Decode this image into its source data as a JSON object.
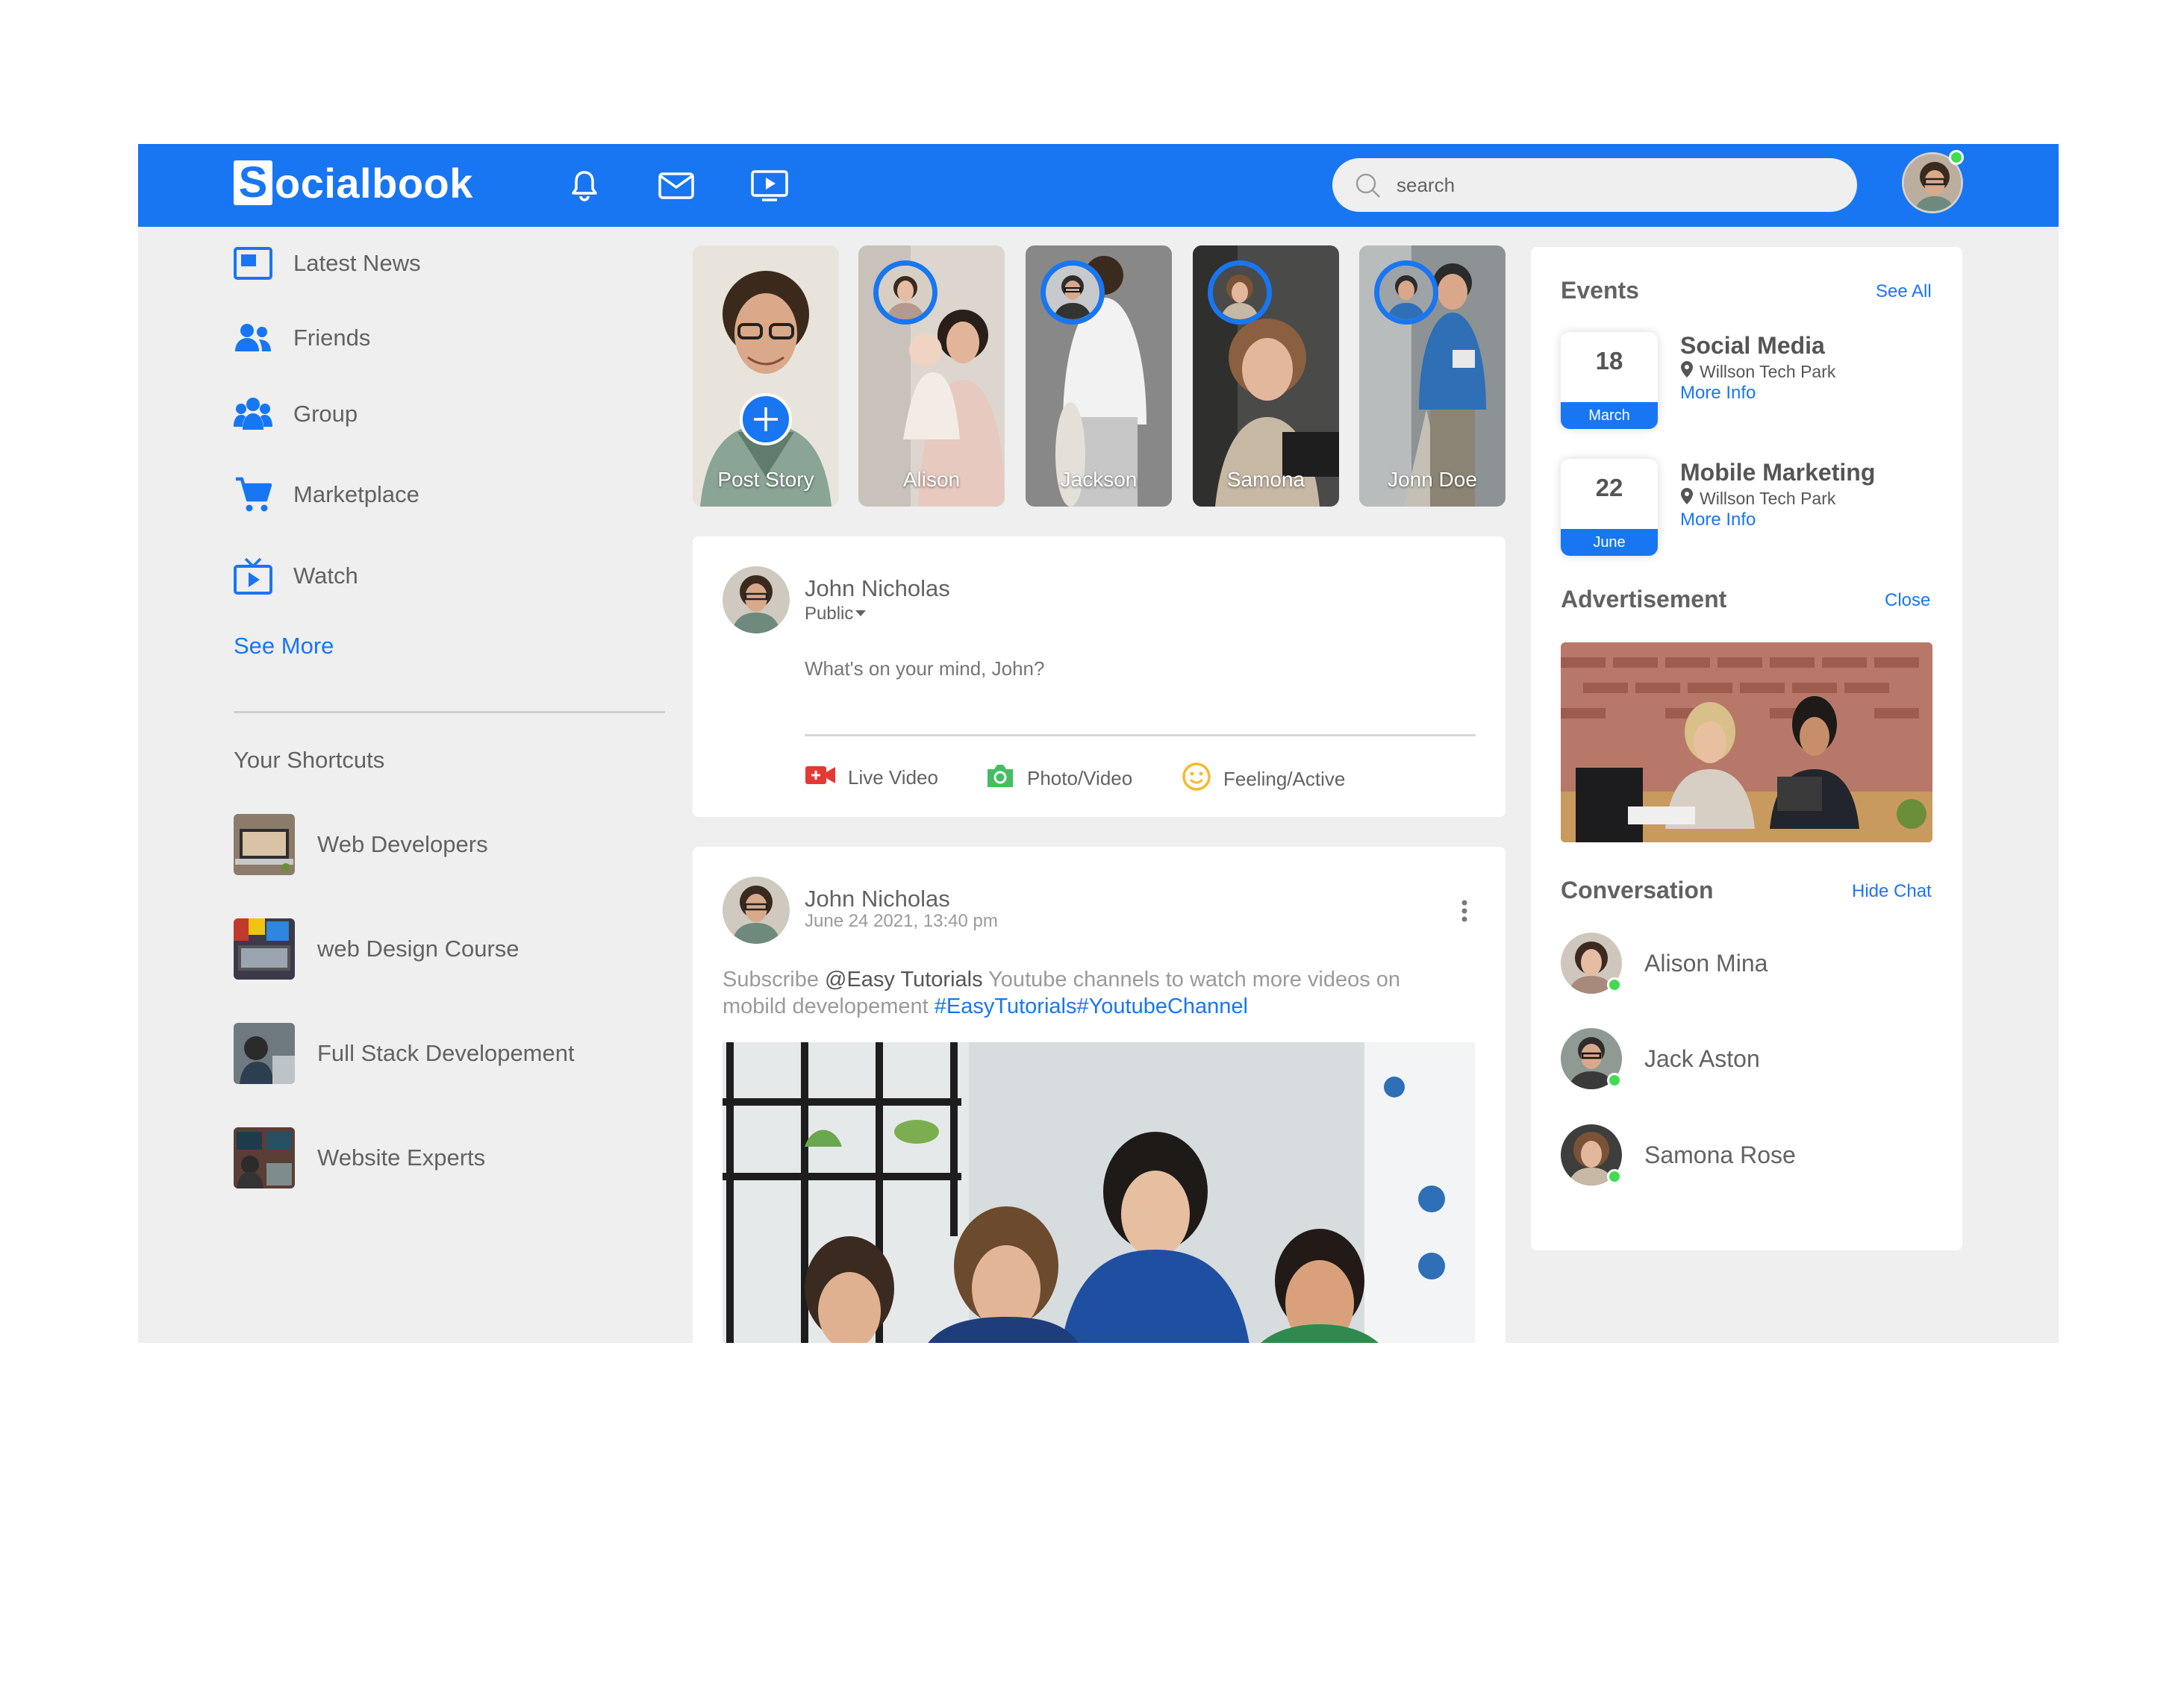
{
  "app": {
    "logo_initial": "S",
    "logo_rest": "ocialbook"
  },
  "topbar": {
    "icons": [
      "notification-bell-icon",
      "inbox-mail-icon",
      "video-play-icon"
    ],
    "search_placeholder": "search"
  },
  "sidebar": {
    "items": [
      {
        "label": "Latest News",
        "icon": "news-icon"
      },
      {
        "label": "Friends",
        "icon": "friends-icon"
      },
      {
        "label": "Group",
        "icon": "group-icon"
      },
      {
        "label": "Marketplace",
        "icon": "cart-icon"
      },
      {
        "label": "Watch",
        "icon": "tv-icon"
      }
    ],
    "see_more": "See More",
    "shortcuts_title": "Your Shortcuts",
    "shortcuts": [
      {
        "label": "Web Developers"
      },
      {
        "label": "web Design Course"
      },
      {
        "label": "Full Stack Developement"
      },
      {
        "label": "Website Experts"
      }
    ]
  },
  "stories": [
    {
      "name": "Post Story"
    },
    {
      "name": "Alison"
    },
    {
      "name": "Jackson"
    },
    {
      "name": "Samona"
    },
    {
      "name": "Jonn Doe"
    }
  ],
  "composer": {
    "user_name": "John Nicholas",
    "privacy": "Public",
    "placeholder": "What's on your mind, John?",
    "actions": [
      {
        "label": "Live Video",
        "icon": "live-video-icon",
        "color": "#e53935"
      },
      {
        "label": "Photo/Video",
        "icon": "camera-icon",
        "color": "#45bd62"
      },
      {
        "label": "Feeling/Active",
        "icon": "smiley-icon",
        "color": "#f7b928"
      }
    ]
  },
  "post": {
    "user_name": "John Nicholas",
    "timestamp": "June 24 2021, 13:40 pm",
    "text_prefix": "Subscribe ",
    "mention": "@Easy Tutorials",
    "text_middle": " Youtube channels to watch more videos on mobild developement ",
    "hashtags": "#EasyTutorials#YoutubeChannel"
  },
  "events": {
    "title": "Events",
    "see_all": "See All",
    "items": [
      {
        "day": "18",
        "month": "March",
        "title": "Social Media",
        "location": "Willson Tech Park",
        "more": "More Info"
      },
      {
        "day": "22",
        "month": "June",
        "title": "Mobile Marketing",
        "location": "Willson Tech Park",
        "more": "More Info"
      }
    ]
  },
  "advertisement": {
    "title": "Advertisement",
    "close": "Close"
  },
  "conversation": {
    "title": "Conversation",
    "hide": "Hide Chat",
    "contacts": [
      {
        "name": "Alison Mina",
        "online": true
      },
      {
        "name": "Jack Aston",
        "online": true
      },
      {
        "name": "Samona Rose",
        "online": true
      }
    ]
  },
  "colors": {
    "brand": "#1876f2",
    "background": "#efefef",
    "online": "#41db51",
    "text": "#626262"
  }
}
